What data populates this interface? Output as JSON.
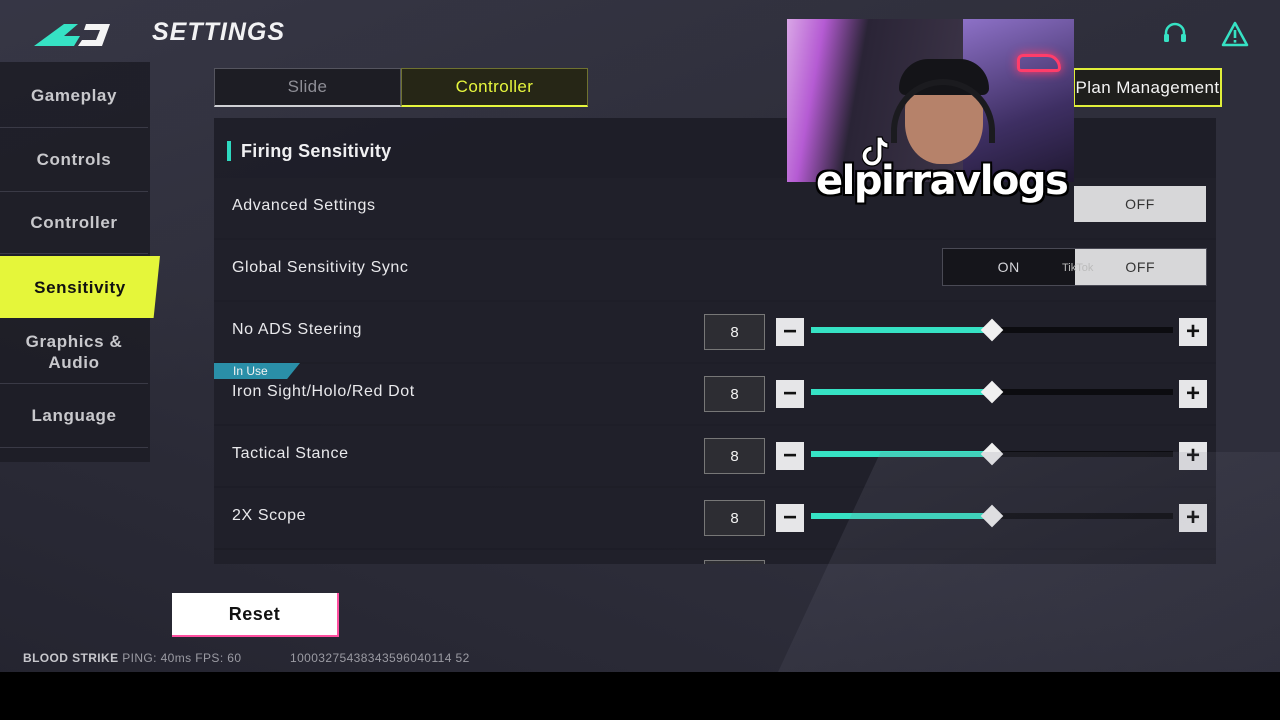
{
  "header": {
    "title": "SETTINGS",
    "logo_icon": "blood-strike-logo",
    "support_icon": "headset-icon",
    "alert_icon": "warning-icon",
    "accent_color": "#e5f63a",
    "teal_color": "#36e2c4"
  },
  "sidebar": {
    "items": [
      {
        "label": "Gameplay"
      },
      {
        "label": "Controls"
      },
      {
        "label": "Controller"
      },
      {
        "label": "Sensitivity",
        "active": true
      },
      {
        "label": "Graphics & Audio"
      },
      {
        "label": "Language"
      }
    ]
  },
  "tabs": [
    {
      "label": "Slide",
      "active": false
    },
    {
      "label": "Controller",
      "active": true
    }
  ],
  "plan_management": "Plan Management",
  "section": {
    "title": "Firing Sensitivity"
  },
  "settings": {
    "advanced": {
      "label": "Advanced Settings",
      "off_label": "OFF"
    },
    "global_sync": {
      "label": "Global Sensitivity Sync",
      "on_label": "ON",
      "off_label": "OFF"
    },
    "sliders": [
      {
        "label": "No ADS Steering",
        "value": "8",
        "level": 0.5
      },
      {
        "label": "Iron Sight/Holo/Red Dot",
        "value": "8",
        "level": 0.5,
        "badge": "In Use"
      },
      {
        "label": "Tactical Stance",
        "value": "8",
        "level": 0.5
      },
      {
        "label": "2X Scope",
        "value": "8",
        "level": 0.5
      }
    ]
  },
  "overlay": {
    "watermark": "elpirravlogs",
    "tiktok_small": "TikTok"
  },
  "reset_label": "Reset",
  "footer": {
    "game": "BLOOD STRIKE",
    "stats": "PING: 40ms FPS: 60",
    "id": "10003275438343596040114 52"
  }
}
